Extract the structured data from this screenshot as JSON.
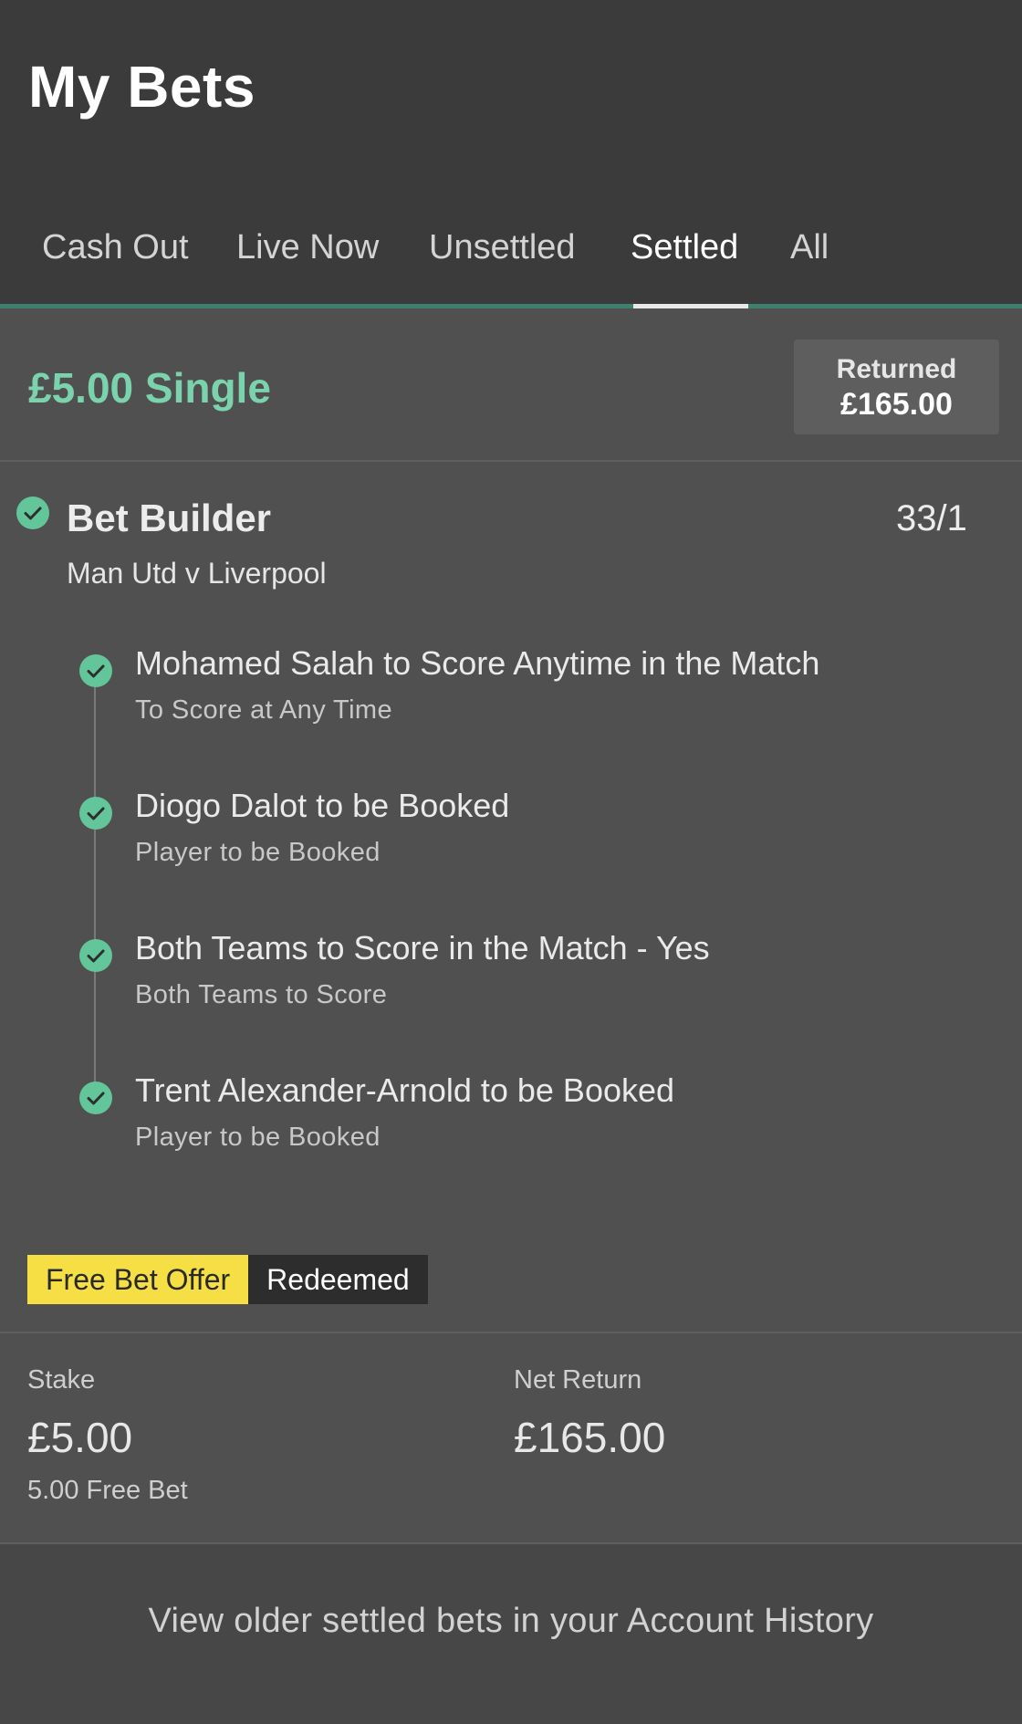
{
  "header": {
    "title": "My Bets"
  },
  "tabs": [
    {
      "label": "Cash Out",
      "active": false
    },
    {
      "label": "Live Now",
      "active": false
    },
    {
      "label": "Unsettled",
      "active": false
    },
    {
      "label": "Settled",
      "active": true
    },
    {
      "label": "All",
      "active": false
    }
  ],
  "bet": {
    "title": "£5.00 Single",
    "returned_label": "Returned",
    "returned_value": "£165.00",
    "builder_title": "Bet Builder",
    "odds": "33/1",
    "match": "Man Utd v Liverpool",
    "selections": [
      {
        "title": "Mohamed Salah to Score Anytime in the Match",
        "market": "To Score at Any Time",
        "status": "won"
      },
      {
        "title": "Diogo Dalot to be Booked",
        "market": "Player to be Booked",
        "status": "won"
      },
      {
        "title": "Both Teams to Score in the Match - Yes",
        "market": "Both Teams to Score",
        "status": "won"
      },
      {
        "title": "Trent Alexander-Arnold to be Booked",
        "market": "Player to be Booked",
        "status": "won"
      }
    ],
    "offer_label": "Free Bet Offer",
    "offer_status": "Redeemed",
    "stake_label": "Stake",
    "stake_value": "£5.00",
    "stake_sub": "5.00 Free Bet",
    "net_return_label": "Net Return",
    "net_return_value": "£165.00"
  },
  "footer": {
    "link_text": "View older settled bets in your Account History"
  },
  "colors": {
    "accent_green": "#7ad3ad",
    "check_green": "#63c59a",
    "offer_yellow": "#f6df44",
    "header_bg": "#3b3b3b",
    "card_bg": "#505050"
  },
  "icons": {
    "selection_status": "check-circle-icon"
  }
}
